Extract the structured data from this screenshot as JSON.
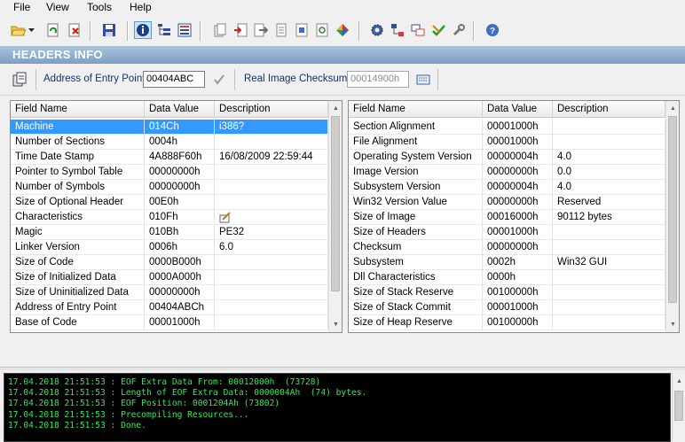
{
  "menu": [
    "File",
    "View",
    "Tools",
    "Help"
  ],
  "header": {
    "title": "HEADERS INFO"
  },
  "address": {
    "entry_label": "Address of Entry Point:",
    "entry_value": "00404ABC",
    "checksum_label": "Real Image Checksum:",
    "checksum_value": "00014900h"
  },
  "colors": {
    "selection": "#3399ff",
    "log_text": "#34e85a",
    "band": "#7e9fc2"
  },
  "left_table": {
    "columns": [
      "Field Name",
      "Data Value",
      "Description"
    ],
    "rows": [
      [
        "Machine",
        "014Ch",
        "i386?"
      ],
      [
        "Number of Sections",
        "0004h",
        ""
      ],
      [
        "Time Date Stamp",
        "4A888F60h",
        "16/08/2009  22:59:44"
      ],
      [
        "Pointer to Symbol Table",
        "00000000h",
        ""
      ],
      [
        "Number of Symbols",
        "00000000h",
        ""
      ],
      [
        "Size of Optional Header",
        "00E0h",
        ""
      ],
      [
        "Characteristics",
        "010Fh",
        ""
      ],
      [
        "Magic",
        "010Bh",
        "PE32"
      ],
      [
        "Linker Version",
        "0006h",
        "6.0"
      ],
      [
        "Size of Code",
        "0000B000h",
        ""
      ],
      [
        "Size of Initialized Data",
        "0000A000h",
        ""
      ],
      [
        "Size of Uninitialized Data",
        "00000000h",
        ""
      ],
      [
        "Address of Entry Point",
        "00404ABCh",
        ""
      ],
      [
        "Base of Code",
        "00001000h",
        ""
      ]
    ]
  },
  "right_table": {
    "columns": [
      "Field Name",
      "Data Value",
      "Description"
    ],
    "rows": [
      [
        "Section Alignment",
        "00001000h",
        ""
      ],
      [
        "File Alignment",
        "00001000h",
        ""
      ],
      [
        "Operating System Version",
        "00000004h",
        "4.0"
      ],
      [
        "Image Version",
        "00000000h",
        "0.0"
      ],
      [
        "Subsystem Version",
        "00000004h",
        "4.0"
      ],
      [
        "Win32 Version Value",
        "00000000h",
        "Reserved"
      ],
      [
        "Size of Image",
        "00016000h",
        "90112 bytes"
      ],
      [
        "Size of Headers",
        "00001000h",
        ""
      ],
      [
        "Checksum",
        "00000000h",
        ""
      ],
      [
        "Subsystem",
        "0002h",
        "Win32 GUI"
      ],
      [
        "Dll Characteristics",
        "0000h",
        ""
      ],
      [
        "Size of Stack Reserve",
        "00100000h",
        ""
      ],
      [
        "Size of Stack Commit",
        "00001000h",
        ""
      ],
      [
        "Size of Heap Reserve",
        "00100000h",
        ""
      ]
    ]
  },
  "log": [
    "17.04.2018 21:51:53 : EOF Extra Data From: 00012000h  (73728)",
    "17.04.2018 21:51:53 : Length of EOF Extra Data: 0000004Ah  (74) bytes.",
    "17.04.2018 21:51:53 : EOF Position: 0001204Ah (73802)",
    "17.04.2018 21:51:53 : Precompiling Resources...",
    "17.04.2018 21:51:53 : Done."
  ]
}
